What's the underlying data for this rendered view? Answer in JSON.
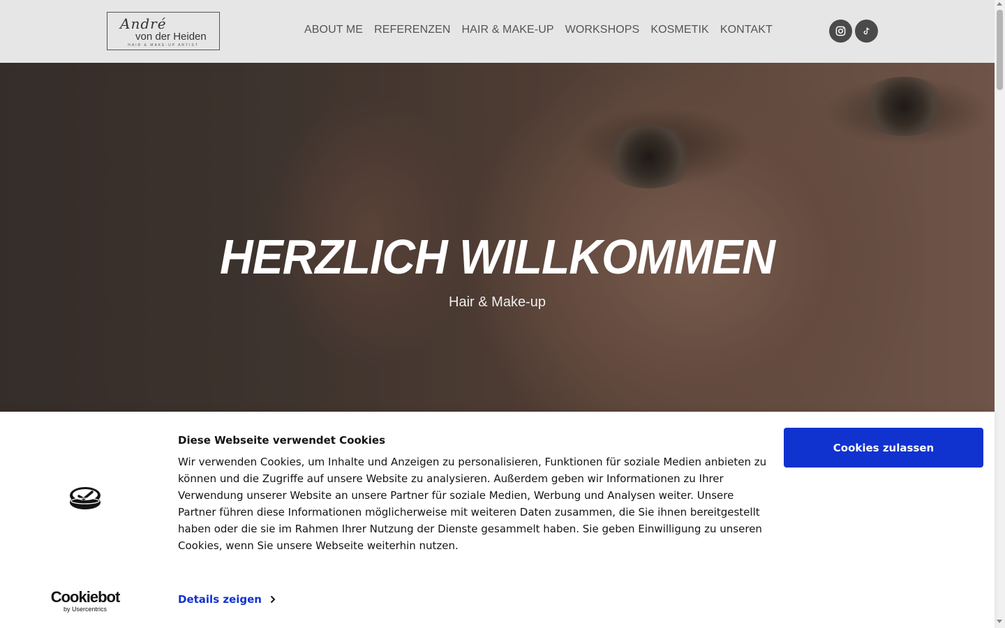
{
  "header": {
    "logo": {
      "script_text": "André",
      "name_text": "von der Heiden",
      "tagline": "HAIR & MAKE-UP ARTIST"
    },
    "nav": [
      {
        "label": "ABOUT ME"
      },
      {
        "label": "REFERENZEN"
      },
      {
        "label": "HAIR & MAKE-UP"
      },
      {
        "label": "WORKSHOPS"
      },
      {
        "label": "KOSMETIK"
      },
      {
        "label": "KONTAKT"
      }
    ],
    "social": [
      {
        "icon": "instagram-icon"
      },
      {
        "icon": "tiktok-icon"
      }
    ]
  },
  "hero": {
    "title": "HERZLICH WILLKOMMEN",
    "subtitle": "Hair & Make-up"
  },
  "cookie_banner": {
    "title": "Diese Webseite verwendet Cookies",
    "text": "Wir verwenden Cookies, um Inhalte und Anzeigen zu personalisieren, Funktionen für soziale Medien anbieten zu können und die Zugriffe auf unsere Website zu analysieren. Außerdem geben wir Informationen zu Ihrer Verwendung unserer Website an unsere Partner für soziale Medien, Werbung und Analysen weiter. Unsere Partner führen diese Informationen möglicherweise mit weiteren Daten zusammen, die Sie ihnen bereitgestellt haben oder die sie im Rahmen Ihrer Nutzung der Dienste gesammelt haben. Sie geben Einwilligung zu unseren Cookies, wenn Sie unsere Webseite weiterhin nutzen.",
    "details_label": "Details zeigen",
    "allow_label": "Cookies zulassen",
    "brand_name": "Cookiebot",
    "brand_sub": "by Usercentrics"
  },
  "colors": {
    "accent": "#1032cf",
    "header_bg": "#e6e6e6",
    "social_bg": "#4a4a4a"
  }
}
